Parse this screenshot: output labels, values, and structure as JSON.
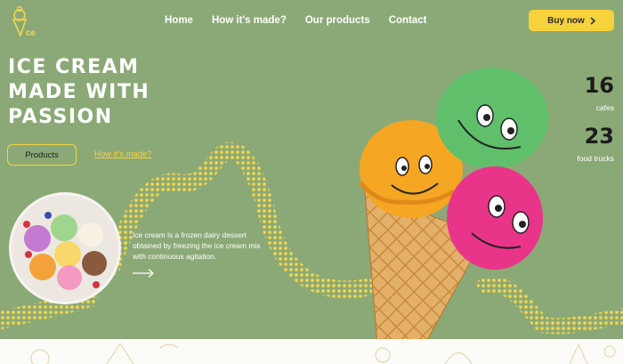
{
  "brand": {
    "logo_text": "ce"
  },
  "nav": {
    "home": "Home",
    "how": "How it's made?",
    "products": "Our products",
    "contact": "Contact"
  },
  "buy_button": {
    "label": "Buy now",
    "icon": "chevron-right-icon"
  },
  "hero": {
    "title_lines": [
      "ICE CREAM",
      "MADE WITH",
      "PASSION"
    ],
    "products_button": "Products",
    "how_link": "How it's made?",
    "description": "Ice cream is a frozen dairy dessert obtained by freezing the ice cream mix with continuous agitation.",
    "arrow_icon": "arrow-right-icon"
  },
  "stats": [
    {
      "value": "16",
      "label": "cafes"
    },
    {
      "value": "23",
      "label": "food trucks"
    }
  ],
  "colors": {
    "background": "#8ba977",
    "accent": "#f7d23c",
    "text_dark": "#1b1b1b",
    "scoop_orange": "#f5a623",
    "scoop_green": "#5fbf6a",
    "scoop_pink": "#e8358a"
  }
}
